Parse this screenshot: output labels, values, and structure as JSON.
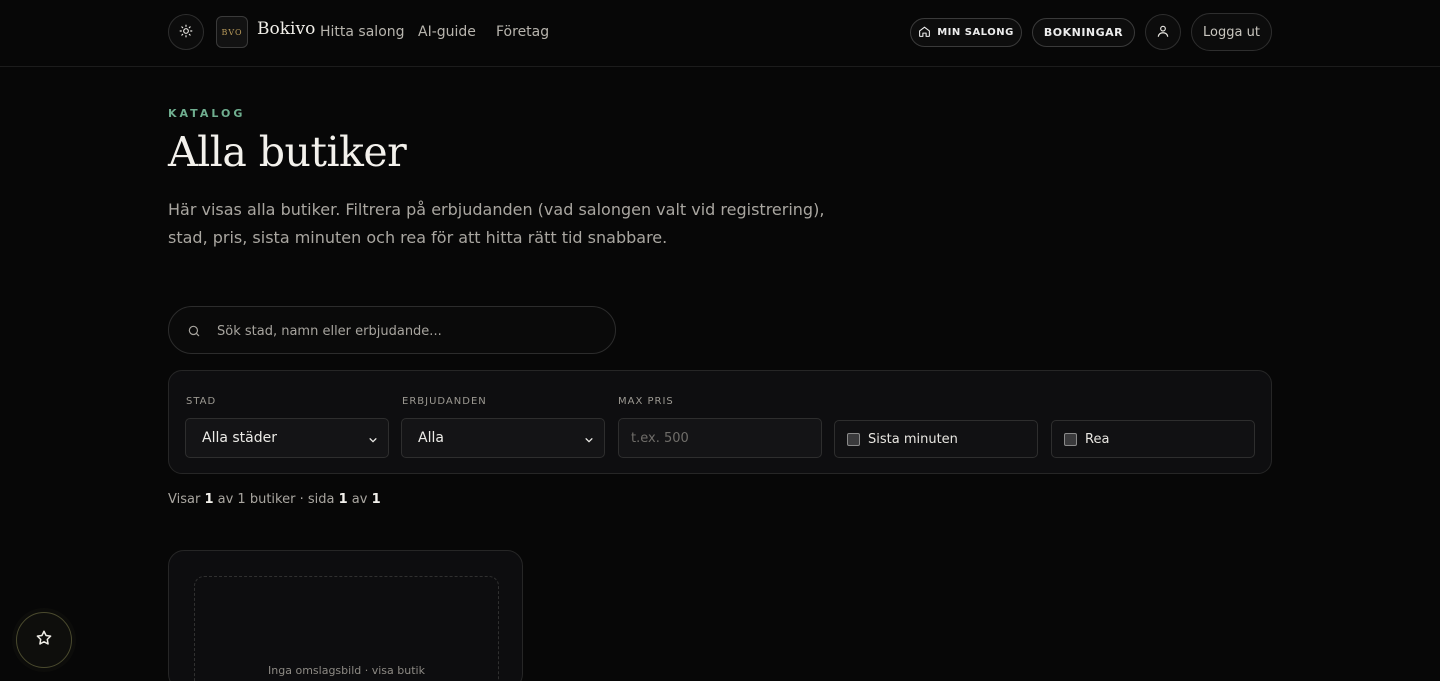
{
  "header": {
    "logo_text": "BVO",
    "brand": "Bokivo",
    "nav": [
      "Hitta salong",
      "AI-guide",
      "Företag"
    ],
    "min_salong": "MIN SALONG",
    "bokningar": "BOKNINGAR",
    "logout": "Logga ut"
  },
  "page": {
    "eyebrow": "KATALOG",
    "title": "Alla butiker",
    "lead": "Här visas alla butiker. Filtrera på erbjudanden (vad salongen valt vid registrering), stad, pris, sista minuten och rea för att hitta rätt tid snabbare."
  },
  "search": {
    "placeholder": "Sök stad, namn eller erbjudande..."
  },
  "filters": {
    "stad_label": "STAD",
    "stad_value": "Alla städer",
    "erbjudanden_label": "ERBJUDANDEN",
    "erbjudanden_value": "Alla",
    "maxpris_label": "MAX PRIS",
    "maxpris_placeholder": "t.ex. 500",
    "sista_minuten": "Sista minuten",
    "rea": "Rea"
  },
  "results": {
    "prefix": "Visar",
    "shown": "1",
    "mid": "av 1 butiker · sida",
    "page": "1",
    "of": "av",
    "pages": "1"
  },
  "card": {
    "cover_text": "Inga omslagsbild · visa butik"
  },
  "colors": {
    "accent": "#6fae8f",
    "background": "#070707",
    "gold": "#b89a5a"
  }
}
